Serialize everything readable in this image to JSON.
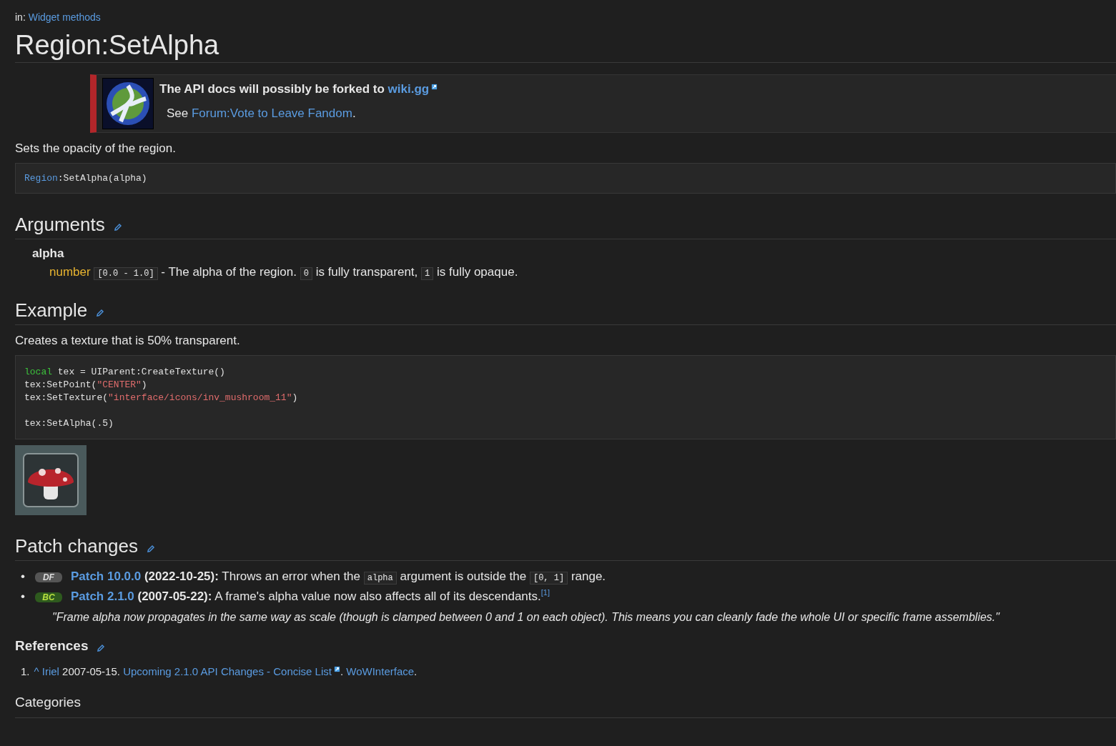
{
  "breadcrumb": {
    "prefix": "in:",
    "link": "Widget methods"
  },
  "title": "Region:SetAlpha",
  "notice": {
    "headline": "The API docs will possibly be forked to",
    "headline_link": "wiki.gg",
    "see": "See",
    "see_link": "Forum:Vote to Leave Fandom",
    "see_end": "."
  },
  "summary": "Sets the opacity of the region.",
  "signature": [
    {
      "kind": "type",
      "text": "Region"
    },
    {
      "kind": "plain",
      "text": ":SetAlpha(alpha)"
    }
  ],
  "arguments": {
    "heading": "Arguments",
    "items": [
      {
        "name": "alpha",
        "type": "number",
        "segments": [
          {
            "kind": "code",
            "text": "[0.0 - 1.0]"
          },
          {
            "kind": "text",
            "text": " - The alpha of the region. "
          },
          {
            "kind": "code",
            "text": "0"
          },
          {
            "kind": "text",
            "text": " is fully transparent, "
          },
          {
            "kind": "code",
            "text": "1"
          },
          {
            "kind": "text",
            "text": " is fully opaque."
          }
        ]
      }
    ]
  },
  "example": {
    "heading": "Example",
    "text": "Creates a texture that is 50% transparent.",
    "code_lines": [
      [
        {
          "kind": "keyword",
          "text": "local"
        },
        {
          "kind": "plain",
          "text": " tex = UIParent:CreateTexture()"
        }
      ],
      [
        {
          "kind": "plain",
          "text": "tex:SetPoint("
        },
        {
          "kind": "string",
          "text": "\"CENTER\""
        },
        {
          "kind": "plain",
          "text": ")"
        }
      ],
      [
        {
          "kind": "plain",
          "text": "tex:SetTexture("
        },
        {
          "kind": "string",
          "text": "\"interface/icons/inv_mushroom_11\""
        },
        {
          "kind": "plain",
          "text": ")"
        }
      ],
      [
        {
          "kind": "blank"
        }
      ],
      [
        {
          "kind": "plain",
          "text": "tex:SetAlpha(.5)"
        }
      ]
    ]
  },
  "patch_changes": {
    "heading": "Patch changes",
    "items": [
      {
        "bullet": "•",
        "badge": "DF",
        "kind": "df",
        "segments": [
          {
            "kind": "boldlink",
            "text": "Patch 10.0.0"
          },
          {
            "kind": "bold",
            "text": " (2022-10-25):"
          },
          {
            "kind": "text",
            "text": " Throws an error when the "
          },
          {
            "kind": "code",
            "text": "alpha"
          },
          {
            "kind": "text",
            "text": " argument is outside the "
          },
          {
            "kind": "code",
            "text": "[0, 1]"
          },
          {
            "kind": "text",
            "text": " range."
          }
        ]
      },
      {
        "bullet": "•",
        "badge": "BC",
        "kind": "bc",
        "segments": [
          {
            "kind": "boldlink",
            "text": "Patch 2.1.0"
          },
          {
            "kind": "bold",
            "text": " (2007-05-22):"
          },
          {
            "kind": "text",
            "text": " A frame's alpha value now also affects all of its descendants."
          },
          {
            "kind": "sup",
            "text": "[1]"
          }
        ]
      }
    ],
    "quote": "\"Frame alpha now propagates in the same way as scale (though is clamped between 0 and 1 on each object). This means you can cleanly fade the whole UI or specific frame assemblies.\""
  },
  "references": {
    "heading": "References",
    "items": [
      {
        "number": "1.",
        "segments": [
          {
            "kind": "link",
            "text": "^ Iriel"
          },
          {
            "kind": "text",
            "text": " 2007-05-15. "
          },
          {
            "kind": "extlink",
            "text": "Upcoming 2.1.0 API Changes - Concise List"
          },
          {
            "kind": "text",
            "text": ". "
          },
          {
            "kind": "link",
            "text": "WoWInterface"
          },
          {
            "kind": "text",
            "text": "."
          }
        ]
      }
    ]
  },
  "categories": {
    "heading": "Categories"
  }
}
